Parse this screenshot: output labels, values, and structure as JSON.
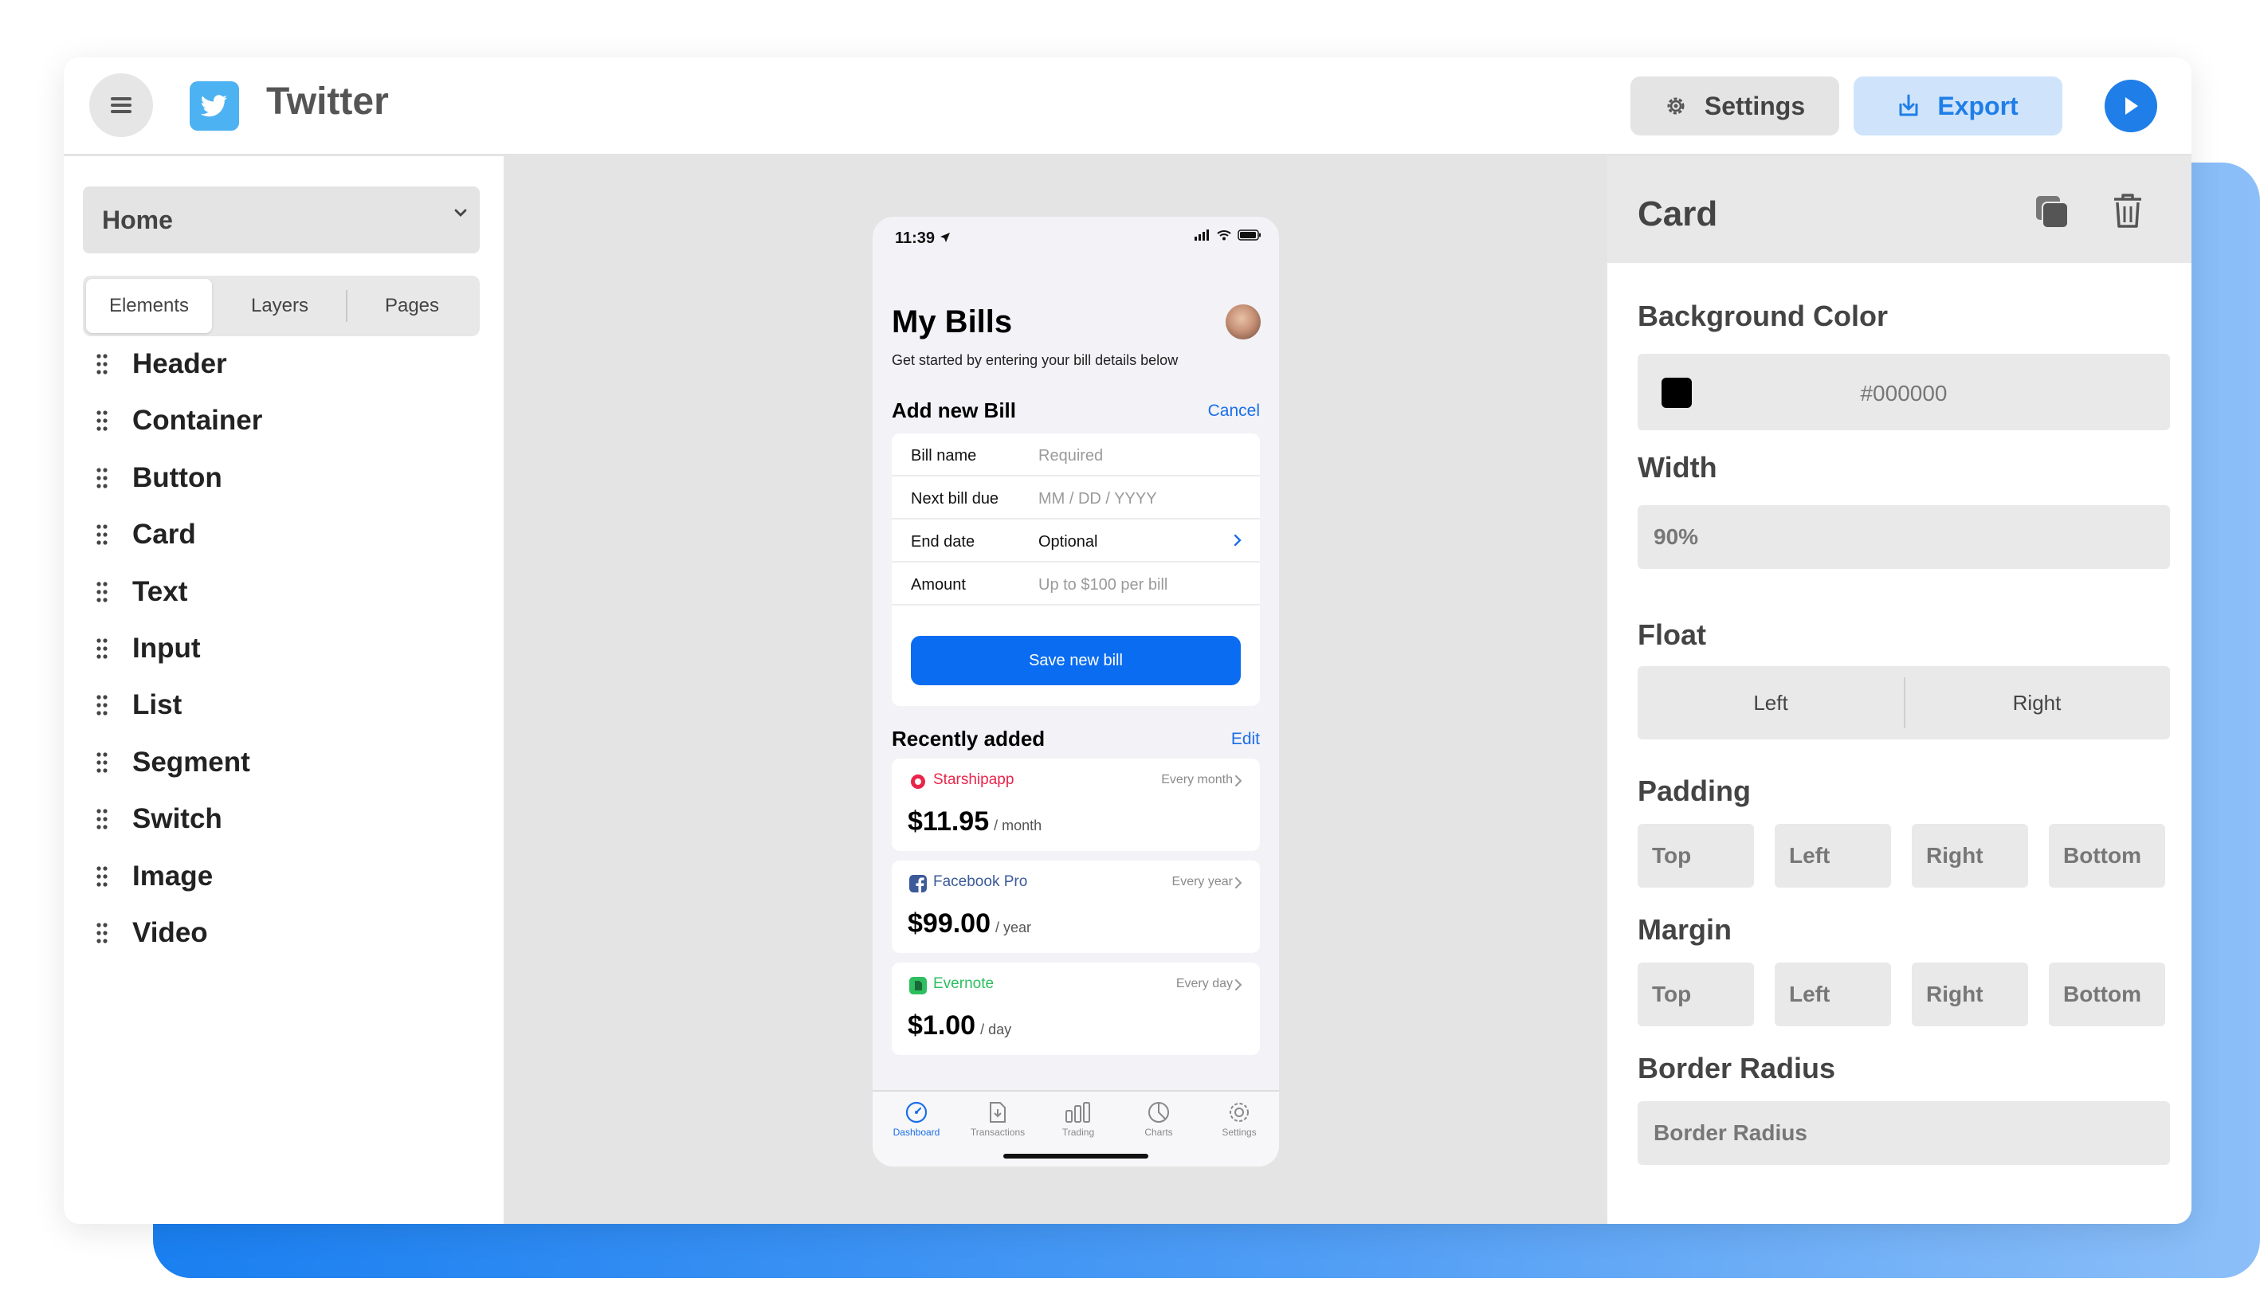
{
  "app": {
    "title": "Twitter"
  },
  "toolbar": {
    "settings_label": "Settings",
    "export_label": "Export"
  },
  "colors": {
    "accent": "#1f7ee8",
    "phone_primary": "#0a6cf0",
    "starship": "#e8254a",
    "facebook": "#3c5a9a",
    "evernote": "#2dbe60"
  },
  "sidebar": {
    "page_select": "Home",
    "tabs": [
      "Elements",
      "Layers",
      "Pages"
    ],
    "active_tab": "Elements",
    "elements": [
      "Header",
      "Container",
      "Button",
      "Card",
      "Text",
      "Input",
      "List",
      "Segment",
      "Switch",
      "Image",
      "Video"
    ]
  },
  "phone": {
    "time": "11:39",
    "title": "My Bills",
    "subtitle": "Get started by entering your bill details below",
    "add_section": {
      "title": "Add new Bill",
      "action": "Cancel"
    },
    "form": [
      {
        "label": "Bill name",
        "value": "Required",
        "placeholder": true
      },
      {
        "label": "Next bill due",
        "value": "MM / DD / YYYY",
        "placeholder": true
      },
      {
        "label": "End date",
        "value": "Optional",
        "placeholder": false
      },
      {
        "label": "Amount",
        "value": "Up to $100 per bill",
        "placeholder": true
      }
    ],
    "save_label": "Save new bill",
    "recent_section": {
      "title": "Recently added",
      "action": "Edit"
    },
    "bills": [
      {
        "name": "Starshipapp",
        "frequency": "Every month",
        "amount": "$11.95",
        "per": "/ month"
      },
      {
        "name": "Facebook Pro",
        "frequency": "Every year",
        "amount": "$99.00",
        "per": "/ year"
      },
      {
        "name": "Evernote",
        "frequency": "Every day",
        "amount": "$1.00",
        "per": "/ day"
      }
    ],
    "tabs": [
      "Dashboard",
      "Transactions",
      "Trading",
      "Charts",
      "Settings"
    ],
    "active_tab": "Dashboard"
  },
  "panel": {
    "title": "Card",
    "background_color": {
      "label": "Background Color",
      "value": "#000000"
    },
    "width": {
      "label": "Width",
      "value": "90%"
    },
    "float": {
      "label": "Float",
      "options": [
        "Left",
        "Right"
      ]
    },
    "padding": {
      "label": "Padding",
      "fields": [
        "Top",
        "Left",
        "Right",
        "Bottom"
      ]
    },
    "margin": {
      "label": "Margin",
      "fields": [
        "Top",
        "Left",
        "Right",
        "Bottom"
      ]
    },
    "border_radius": {
      "label": "Border Radius",
      "placeholder": "Border Radius"
    }
  }
}
